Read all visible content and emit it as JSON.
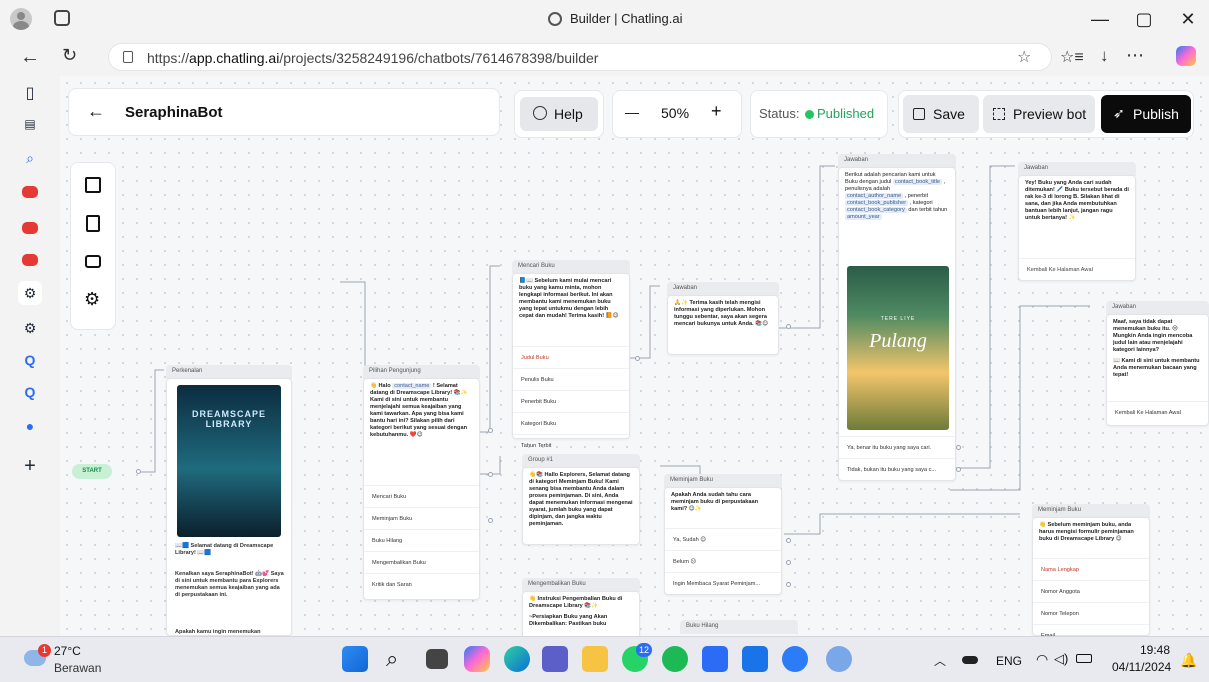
{
  "browser": {
    "tab_title": "Builder | Chatling.ai",
    "url_prefix": "https://",
    "url_host": "app.chatling.ai",
    "url_path": "/projects/3258249196/chatbots/7614678398/builder",
    "win_min": "—",
    "win_max": "▢",
    "win_close": "✕"
  },
  "toolbar": {
    "back_icon": "←",
    "bot_name": "SeraphinaBot",
    "help_label": "Help",
    "zoom_out": "—",
    "zoom_value": "50%",
    "zoom_in": "+",
    "status_label": "Status:",
    "status_value": "Published",
    "save_label": "Save",
    "preview_label": "Preview bot",
    "publish_label": "Publish",
    "status_color": "#22c55e"
  },
  "start_label": "START",
  "nodes": {
    "perkenalan": {
      "title": "Perkenalan",
      "msg1": "📖🟦 Selamat datang di Dreamscape Library! 📖🟦",
      "msg2": "Kenalkan saya SeraphinaBot! 🤖💕 Saya di sini untuk membantu para Explorers menemukan semua keajaiban yang ada di perpustakaan ini.",
      "msg3": "Apakah kamu ingin menemukan",
      "cover_text": "DREAMSCAPE LIBRARY"
    },
    "pilihan": {
      "title": "Pilihan Pengunjung",
      "greet": "👋 Halo",
      "greet_var": "contact_name",
      "greet2": "! Selamat datang di Dreamscape Library! 📚✨",
      "body": "Kami di sini untuk membantu menjelajahi semua keajaiban yang kami tawarkan. Apa yang bisa kami bantu hari ini? Silakan pilih dari kategori berikut yang sesuai dengan kebutuhanmu. ❤️😊",
      "options": [
        "Mencari Buku",
        "Meminjam Buku",
        "Buku Hilang",
        "Mengembalikan Buku",
        "Kritik dan Saran"
      ]
    },
    "mencari": {
      "title": "Mencari Buku",
      "body": "📘📖 Sebelum kami mulai mencari buku yang kamu minta, mohon lengkapi informasi berikut. Ini akan membantu kami menemukan buku yang tepat untukmu dengan lebih cepat dan mudah! Terima kasih! 📙😊",
      "form_title": "Judul Buku",
      "fields": [
        "Penulis Buku",
        "Penerbit Buku",
        "Kategori Buku",
        "Tahun Terbit"
      ]
    },
    "jawaban1": {
      "title": "Jawaban",
      "body": "🙏✨ Terima kasih telah mengisi informasi yang diperlukan. Mohon tunggu sebentar, saya akan segera mencari bukunya untuk Anda. 📚😊"
    },
    "jawaban2": {
      "title": "Jawaban",
      "body1": "Berikut adalah pencarian kami untuk Buku dengan judul",
      "v1": "contact_book_title",
      "body2": ", penulisnya adalah",
      "v2": "contact_author_name",
      "body3": ", penerbit",
      "v3": "contact_book_publisher",
      "body4": ", kategori",
      "v4": "contact_book_category",
      "body5": "dan terbit tahun",
      "v5": "amount_year",
      "book_title": "Pulang",
      "book_author": "TERE LIYE",
      "opt1": "Ya, benar itu buku yang saya cari.",
      "opt2": "Tidak, bukan itu buku yang saya c..."
    },
    "jawaban3": {
      "title": "Jawaban",
      "body": "Yey! Buku yang Anda cari sudah ditemukan! 🖊️ Buku tersebut berada di rak ke-3 di lorong B. Silakan lihat di sana, dan jika Anda membutuhkan bantuan lebih lanjut, jangan ragu untuk bertanya! ✨",
      "opt": "Kembali Ke Halaman Awal"
    },
    "jawaban4": {
      "title": "Jawaban",
      "body": "Maaf, saya tidak dapat menemukan buku itu. 😔 Mungkin Anda ingin mencoba judul lain atau menjelajahi kategori lainnya?",
      "body2": "📖 Kami di sini untuk membantu Anda menemukan bacaan yang tepat!",
      "opt": "Kembali Ke Halaman Awal"
    },
    "group": {
      "title": "Group #1",
      "body": "👋📚 Hallo Explorers, Selamat datang di kategori Meminjam Buku! Kami senang bisa membantu Anda dalam proses peminjaman. Di sini, Anda dapat menemukan informasi mengenai syarat, jumlah buku yang dapat dipinjam, dan jangka waktu peminjaman."
    },
    "meminjam1": {
      "title": "Meminjam Buku",
      "body": "Apakah Anda sudah tahu cara meminjam buku di perpustakaan kami? 😊✨",
      "options": [
        "Ya, Sudah 😊",
        "Belum 😕",
        "Ingin Membaca Syarat Peminjam..."
      ]
    },
    "meminjam2": {
      "title": "Meminjam Buku",
      "body": "👋 Sebelum meminjam buku, anda harus mengisi formulir peminjaman buku di Dreamscape Library 😊",
      "form_title": "Nama Lengkap",
      "fields": [
        "Nomor Anggota",
        "Nomor Telepon",
        "Email"
      ]
    },
    "mengembalikan": {
      "title": "Mengembalikan Buku",
      "body": "👋 Instruksi Pengembalian Buku di Dreamscape Library 📚✨",
      "body2": "~Persiapkan Buku yang Akan Dikembalikan: Pastikan buku"
    },
    "hilang": {
      "title": "Buku Hilang"
    }
  },
  "taskbar": {
    "temp": "27°C",
    "weather": "Berawan",
    "lang": "ENG",
    "time": "19:48",
    "date": "04/11/2024",
    "badge": "1",
    "wa_badge": "12"
  },
  "icons": {
    "left_panel": [
      "layout-icon",
      "code-file-icon",
      "bot-icon",
      "settings-icon"
    ]
  }
}
